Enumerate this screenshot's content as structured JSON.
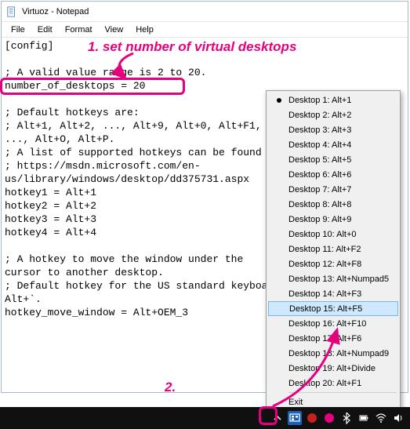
{
  "window": {
    "title": "Virtuoz - Notepad"
  },
  "menubar": {
    "file": "File",
    "edit": "Edit",
    "format": "Format",
    "view": "View",
    "help": "Help"
  },
  "textcontent": "[config]\n\n; A valid value range is 2 to 20.\nnumber_of_desktops = 20\n\n; Default hotkeys are:\n; Alt+1, Alt+2, ..., Alt+9, Alt+0, Alt+F1,\n..., Alt+O, Alt+P.\n; A list of supported hotkeys can be found here:\n; https://msdn.microsoft.com/en-\nus/library/windows/desktop/dd375731.aspx\nhotkey1 = Alt+1\nhotkey2 = Alt+2\nhotkey3 = Alt+3\nhotkey4 = Alt+4\n\n; A hotkey to move the window under the\ncursor to another desktop.\n; Default hotkey for the US standard keyboard is\nAlt+`.\nhotkey_move_window = Alt+OEM_3",
  "annotations": {
    "a1": "1. set number of virtual desktops",
    "a2": "2."
  },
  "ctxmenu": {
    "items": [
      "Desktop 1: Alt+1",
      "Desktop 2: Alt+2",
      "Desktop 3: Alt+3",
      "Desktop 4: Alt+4",
      "Desktop 5: Alt+5",
      "Desktop 6: Alt+6",
      "Desktop 7: Alt+7",
      "Desktop 8: Alt+8",
      "Desktop 9: Alt+9",
      "Desktop 10: Alt+0",
      "Desktop 11: Alt+F2",
      "Desktop 12: Alt+F8",
      "Desktop 13: Alt+Numpad5",
      "Desktop 14: Alt+F3",
      "Desktop 15: Alt+F5",
      "Desktop 16: Alt+F10",
      "Desktop 17: Alt+F6",
      "Desktop 18: Alt+Numpad9",
      "Desktop 19: Alt+Divide",
      "Desktop 20: Alt+F1"
    ],
    "exit": "Exit",
    "selected_index": 0,
    "highlight_index": 14
  }
}
